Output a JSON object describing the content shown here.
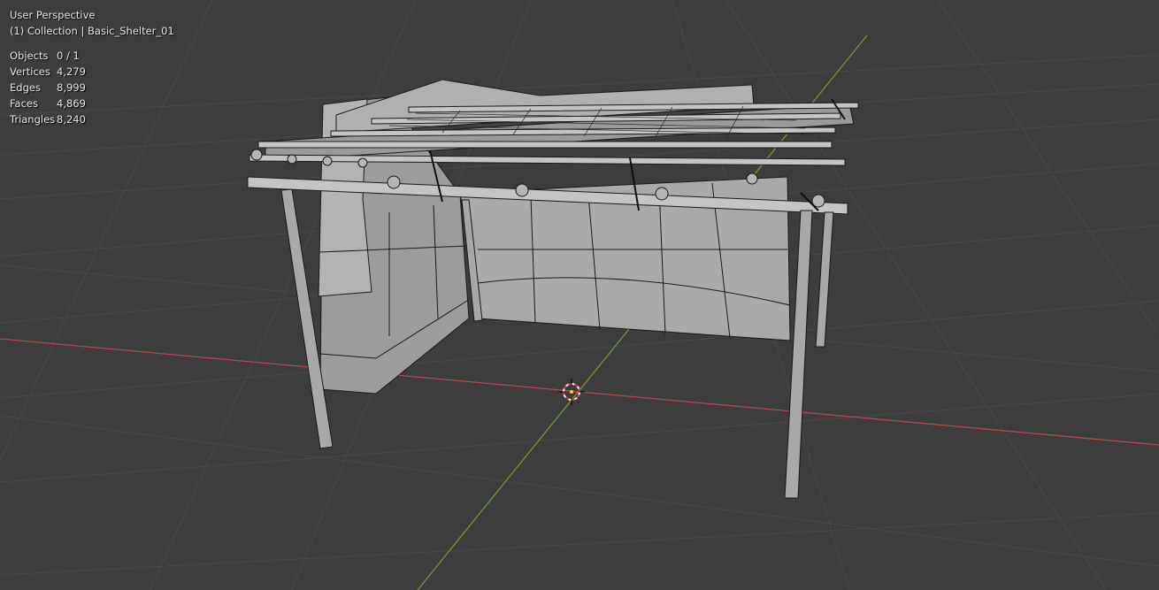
{
  "viewport": {
    "view_name": "User Perspective",
    "collection_line": "(1) Collection | Basic_Shelter_01"
  },
  "stats": [
    {
      "label": "Objects",
      "value": "0 / 1"
    },
    {
      "label": "Vertices",
      "value": "4,279"
    },
    {
      "label": "Edges",
      "value": "8,999"
    },
    {
      "label": "Faces",
      "value": "4,869"
    },
    {
      "label": "Triangles",
      "value": "8,240"
    }
  ],
  "colors": {
    "background": "#3d3d3d",
    "grid": "#484848",
    "x_axis": "#b8454f",
    "y_axis": "#6f9a2e",
    "mesh_face": "#a3a3a3",
    "mesh_edge": "#1a1a1a",
    "cursor": "#d83a3a"
  },
  "icons": [
    "3d-cursor-icon"
  ]
}
